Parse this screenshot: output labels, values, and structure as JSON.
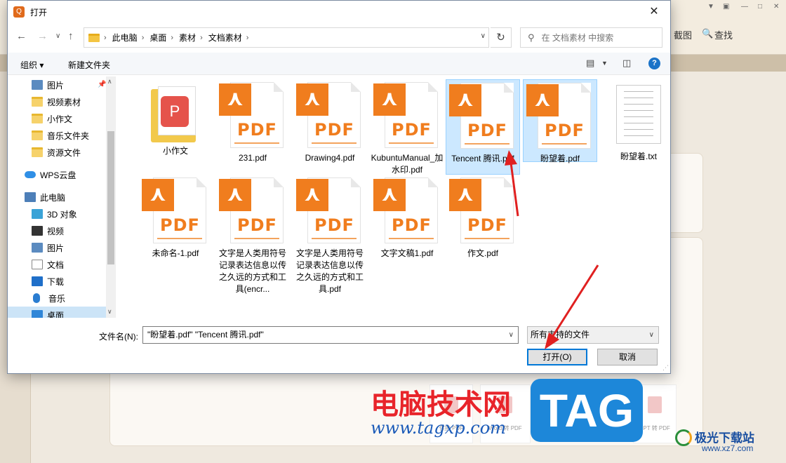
{
  "background": {
    "toolbar_screenshot": "截图",
    "toolbar_search": "查找",
    "cards": [
      "保护 PDF",
      "Word 转 PDF",
      "PPT 转 PDF"
    ]
  },
  "dialog": {
    "title": "打开",
    "breadcrumb": [
      "此电脑",
      "桌面",
      "素材",
      "文档素材"
    ],
    "search_placeholder": "在 文档素材 中搜索",
    "toolbar": {
      "organize": "组织",
      "new_folder": "新建文件夹",
      "help": "?"
    },
    "nav_items": [
      {
        "label": "图片",
        "icon": "pictures-folder-icon",
        "pinned": true
      },
      {
        "label": "视频素材",
        "icon": "folder-icon"
      },
      {
        "label": "小作文",
        "icon": "folder-icon"
      },
      {
        "label": "音乐文件夹",
        "icon": "folder-icon"
      },
      {
        "label": "资源文件",
        "icon": "folder-icon"
      },
      {
        "label": "WPS云盘",
        "icon": "cloud-icon"
      },
      {
        "label": "此电脑",
        "icon": "computer-icon"
      },
      {
        "label": "3D 对象",
        "icon": "3d-objects-icon"
      },
      {
        "label": "视频",
        "icon": "videos-icon"
      },
      {
        "label": "图片",
        "icon": "pictures-icon"
      },
      {
        "label": "文档",
        "icon": "documents-icon"
      },
      {
        "label": "下载",
        "icon": "downloads-icon"
      },
      {
        "label": "音乐",
        "icon": "music-icon"
      },
      {
        "label": "桌面",
        "icon": "desktop-icon",
        "selected": true
      }
    ],
    "files": [
      {
        "name": "小作文",
        "type": "folder"
      },
      {
        "name": "231.pdf",
        "type": "pdf"
      },
      {
        "name": "Drawing4.pdf",
        "type": "pdf"
      },
      {
        "name": "KubuntuManual_加水印.pdf",
        "type": "pdf"
      },
      {
        "name": "Tencent 腾讯.pdf",
        "type": "pdf",
        "selected": true
      },
      {
        "name": "盼望着.pdf",
        "type": "pdf",
        "selected": true
      },
      {
        "name": "盼望着.txt",
        "type": "txt"
      },
      {
        "name": "未命名-1.pdf",
        "type": "pdf"
      },
      {
        "name": "文字是人类用符号记录表达信息以传之久远的方式和工具(encr...",
        "type": "pdf"
      },
      {
        "name": "文字是人类用符号记录表达信息以传之久远的方式和工具.pdf",
        "type": "pdf"
      },
      {
        "name": "文字文稿1.pdf",
        "type": "pdf"
      },
      {
        "name": "作文.pdf",
        "type": "pdf"
      }
    ],
    "pdf_label": "PDF",
    "filename_label": "文件名(N):",
    "filename_value": "\"盼望着.pdf\" \"Tencent 腾讯.pdf\"",
    "filetype_value": "所有支持的文件",
    "open_button": "打开(O)",
    "cancel_button": "取消"
  },
  "watermark": {
    "cn_text": "电脑技术网",
    "url": "www.tagxp.com",
    "tag": "TAG",
    "site_name": "极光下载站",
    "site_url": "www.xz7.com"
  },
  "colors": {
    "pdf_orange": "#f07d1e",
    "selection": "#cce8ff",
    "annotation_arrow": "#e02020"
  }
}
